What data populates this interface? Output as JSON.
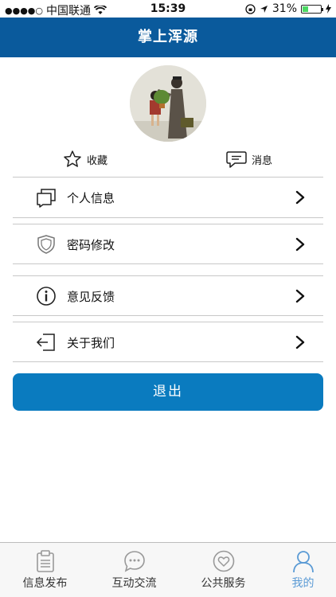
{
  "status_bar": {
    "signal_dots": "●●●●○",
    "carrier": "中国联通",
    "time": "15:39",
    "battery_percent": "31%",
    "battery_level": 0.31
  },
  "header": {
    "title": "掌上浑源"
  },
  "quick_actions": {
    "favorites_label": "收藏",
    "messages_label": "消息"
  },
  "menu": {
    "items": [
      {
        "label": "个人信息",
        "icon": "profile-icon"
      },
      {
        "label": "密码修改",
        "icon": "shield-icon"
      },
      {
        "label": "意见反馈",
        "icon": "info-icon"
      },
      {
        "label": "关于我们",
        "icon": "exit-icon"
      }
    ]
  },
  "logout_label": "退出",
  "tab_bar": {
    "tabs": [
      {
        "label": "信息发布",
        "icon": "clipboard-icon"
      },
      {
        "label": "互动交流",
        "icon": "chat-icon"
      },
      {
        "label": "公共服务",
        "icon": "heart-icon"
      },
      {
        "label": "我的",
        "icon": "person-icon",
        "active": true
      }
    ],
    "active_color": "#5b9bd5"
  },
  "colors": {
    "header_bg": "#0a5a9c",
    "button_bg": "#0a7bbf"
  }
}
